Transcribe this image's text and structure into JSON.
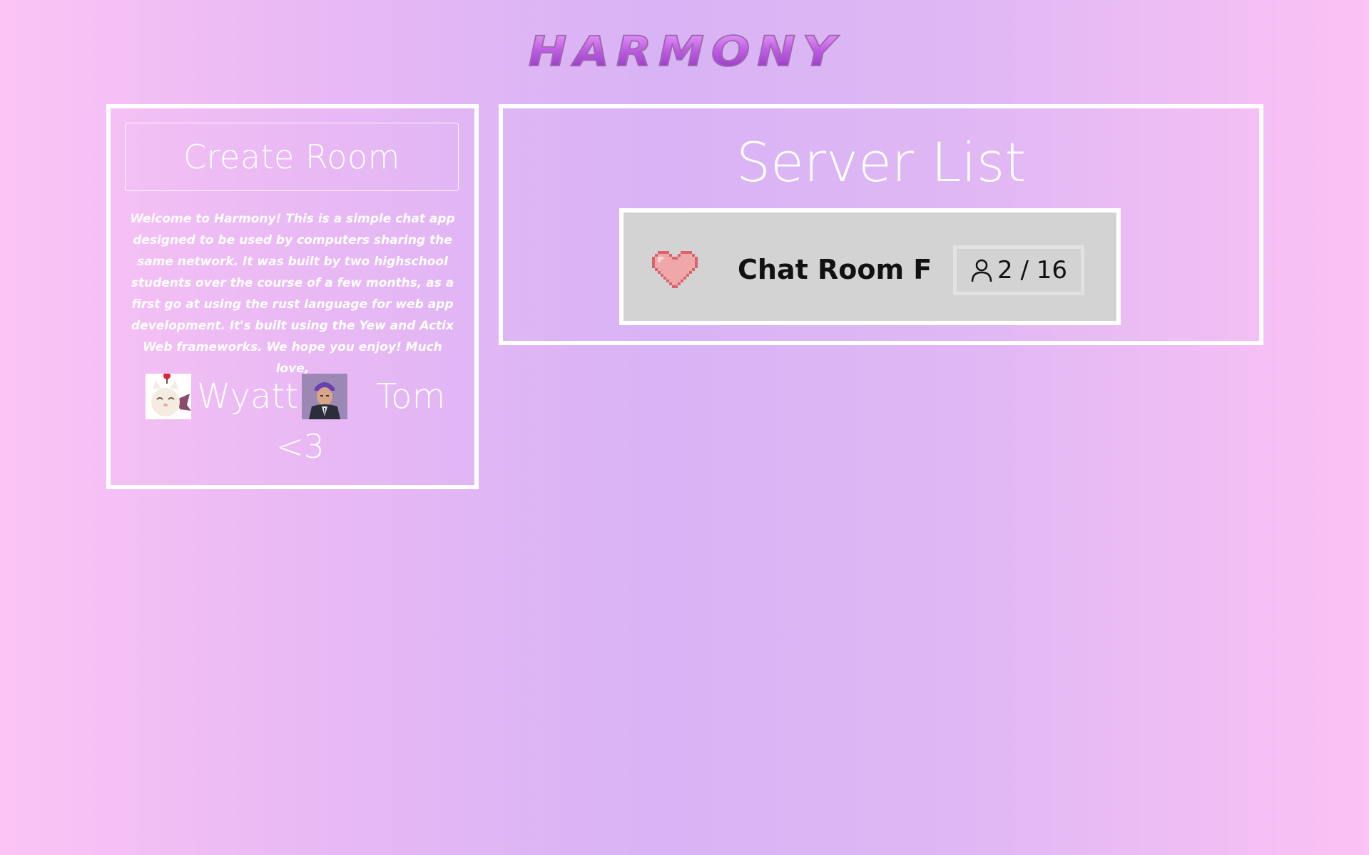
{
  "app": {
    "logo_text": "HARMONY"
  },
  "sidebar": {
    "create_room_label": "Create Room",
    "welcome_text": "Welcome to Harmony! This is a simple chat app designed to be used by computers sharing the same network. It was built by two highschool students over the course of a few months, as a first go at using the rust language for web app development. It's built using the Yew and Actix Web frameworks. We hope you enjoy! Much love,",
    "authors": [
      {
        "name": "Wyatt",
        "avatar_icon": "moogle-avatar-icon"
      },
      {
        "name": "Tom",
        "avatar_icon": "prison-mike-avatar-icon"
      }
    ],
    "sign_off": "<3"
  },
  "server_list": {
    "title": "Server List",
    "rooms": [
      {
        "name": "Chat Room F",
        "icon": "pixel-heart-icon",
        "current_users": 2,
        "max_users": 16,
        "occupancy_text": "2 / 16"
      }
    ]
  },
  "colors": {
    "background_pink": "#fbc4f5",
    "background_lavender": "#d8b3f5",
    "panel_border": "#ffffff",
    "card_background": "#d3d3d3",
    "heart_red": "#d9646d",
    "heart_pink": "#efa7aa",
    "logo_purple": "#c25ee6"
  }
}
